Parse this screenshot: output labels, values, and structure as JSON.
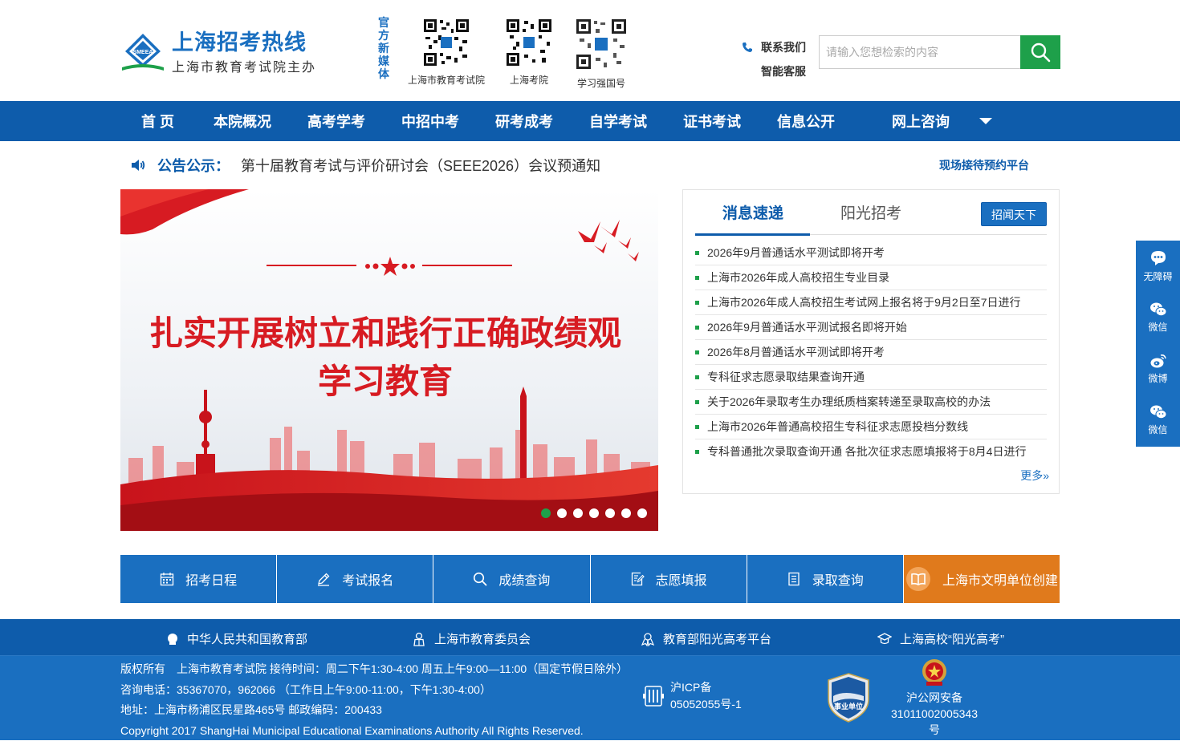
{
  "logo": {
    "title": "上海招考热线",
    "subtitle": "上海市教育考试院主办",
    "emblem_text": "SMEEA"
  },
  "media": {
    "label": "官方新媒体",
    "qrcodes": [
      "上海市教育考试院",
      "上海考院",
      "学习强国号"
    ]
  },
  "contact": {
    "contact_us": "联系我们",
    "service": "智能客服"
  },
  "search": {
    "placeholder": "请输入您想检索的内容"
  },
  "nav": [
    "首 页",
    "本院概况",
    "高考学考",
    "中招中考",
    "研考成考",
    "自学考试",
    "证书考试",
    "信息公开",
    "网上咨询"
  ],
  "notice": {
    "label": "公告公示：",
    "message": "第十届教育考试与评价研讨会（SEEE2026）会议预通知",
    "link": "现场接待预约平台"
  },
  "banner": {
    "headline_1": "扎实开展树立和践行正确政绩观",
    "headline_2": "学习教育",
    "slides": 7,
    "active_slide": 1
  },
  "news": {
    "tabs": [
      "消息速递",
      "阳光招考"
    ],
    "tag": "招闻天下",
    "items": [
      "2026年9月普通话水平测试即将开考",
      "上海市2026年成人高校招生专业目录",
      "上海市2026年成人高校招生考试网上报名将于9月2日至7日进行",
      "2026年9月普通话水平测试报名即将开始",
      "2026年8月普通话水平测试即将开考",
      "专科征求志愿录取结果查询开通",
      "关于2026年录取考生办理纸质档案转递至录取高校的办法",
      "上海市2026年普通高校招生专科征求志愿投档分数线",
      "专科普通批次录取查询开通 各批次征求志愿填报将于8月4日进行"
    ],
    "more": "更多»"
  },
  "quick": [
    "招考日程",
    "考试报名",
    "成绩查询",
    "志愿填报",
    "录取查询",
    "上海市文明单位创建"
  ],
  "links": [
    "中华人民共和国教育部",
    "上海市教育委员会",
    "教育部阳光高考平台",
    "上海高校“阳光高考”"
  ],
  "footer": {
    "line1": "版权所有　上海市教育考试院 接待时间：周二下午1:30-4:00 周五上午9:00—11:00（国定节假日除外）",
    "line2": "咨询电话：35367070，962066 （工作日上午9:00-11:00，下午1:30-4:00）",
    "line3": "地址：上海市杨浦区民星路465号 邮政编码：200433",
    "line4": "Copyright 2017 ShangHai Municipal Educational Examinations Authority All Rights Reserved.",
    "icp_1": "沪ICP备",
    "icp_2": "05052055号-1",
    "badge_text": "事业单位",
    "police_1": "沪公网安备",
    "police_2": "31011002005343",
    "police_3": "号"
  },
  "side": [
    "无障碍",
    "微信",
    "微博",
    "微信"
  ],
  "colors": {
    "nav": "#0e5cab",
    "accent": "#1a6fc0",
    "green": "#1ea04a",
    "orange": "#e07a1c"
  }
}
